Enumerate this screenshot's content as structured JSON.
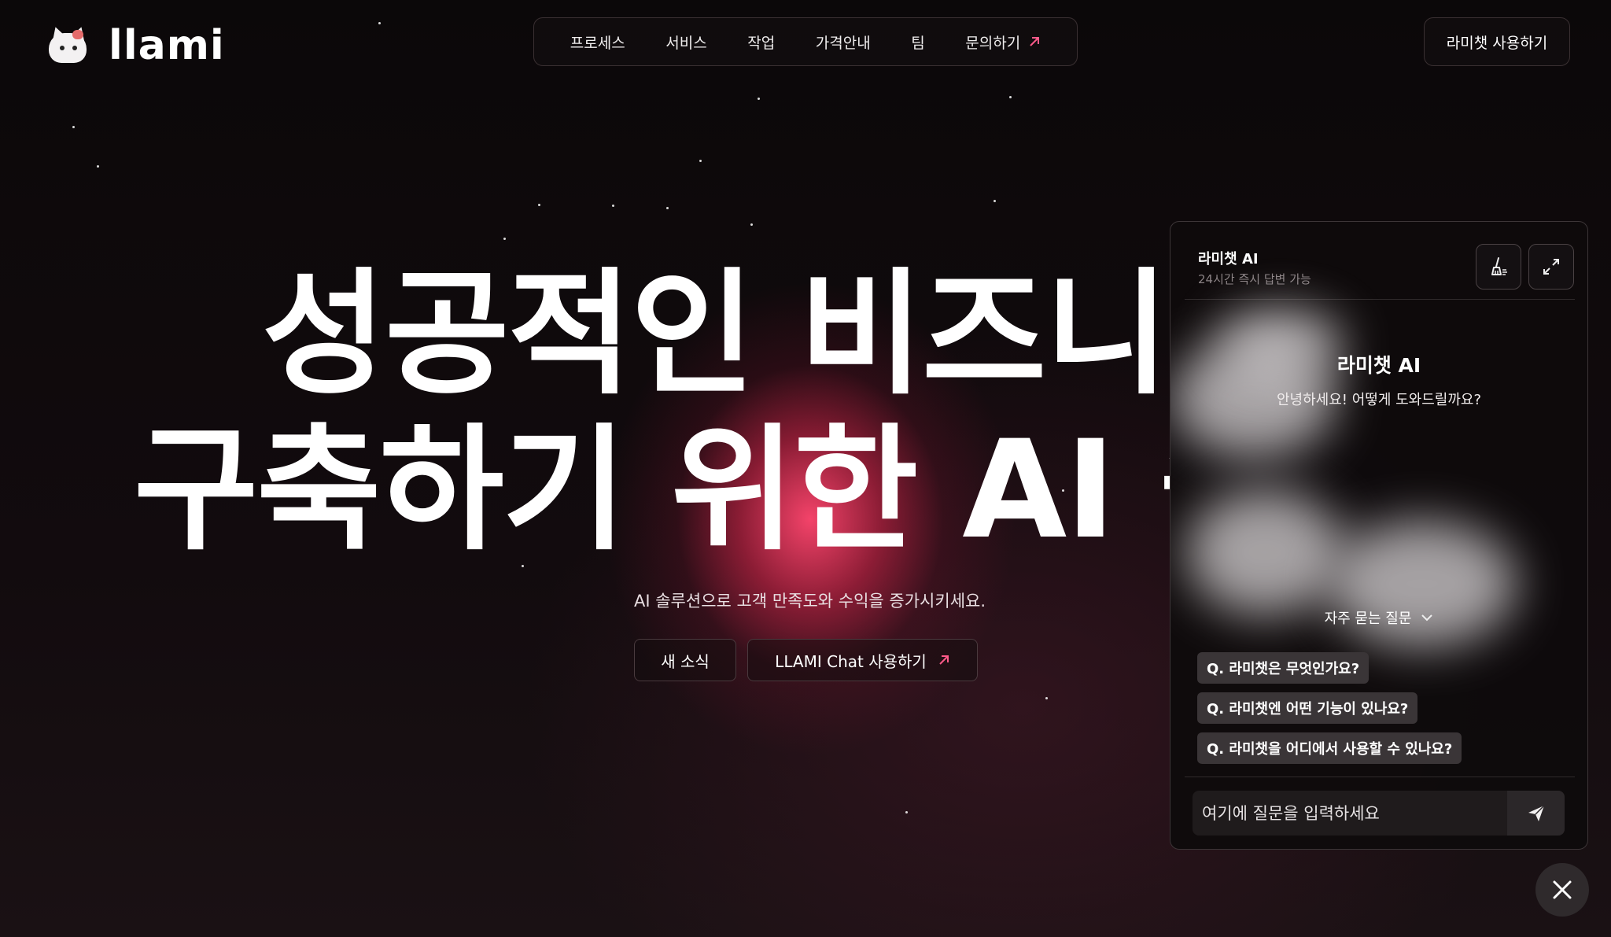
{
  "brand": {
    "name": "llami"
  },
  "nav": {
    "items": [
      {
        "label": "프로세스"
      },
      {
        "label": "서비스"
      },
      {
        "label": "작업"
      },
      {
        "label": "가격안내"
      },
      {
        "label": "팀"
      },
      {
        "label": "문의하기",
        "icon": "arrow-up-right-icon"
      }
    ]
  },
  "header": {
    "cta_label": "라미챗 사용하기"
  },
  "hero": {
    "line1": "성공적인 비즈니스",
    "line2": "구축하기 위한 AI 솔",
    "subtitle": "AI 솔루션으로 고객 만족도와 수익을 증가시키세요.",
    "news_button": "새 소식",
    "chat_button": "LLAMI Chat 사용하기"
  },
  "chat": {
    "title": "라미챗 AI",
    "subtitle": "24시간 즉시 답변 가능",
    "bot_name": "라미챗 AI",
    "greeting": "안녕하세요! 어떻게 도와드릴까요?",
    "faq_toggle": "자주 묻는 질문",
    "faqs": [
      {
        "label": "Q.  라미챗은 무엇인가요?"
      },
      {
        "label": "Q.  라미챗엔 어떤 기능이 있나요?"
      },
      {
        "label": "Q.  라미챗을 어디에서 사용할 수 있나요?"
      }
    ],
    "input_placeholder": "여기에 질문을 입력하세요"
  },
  "colors": {
    "accent": "#ff5a8a",
    "background": "#0c0809",
    "glow": "#ff466e"
  }
}
